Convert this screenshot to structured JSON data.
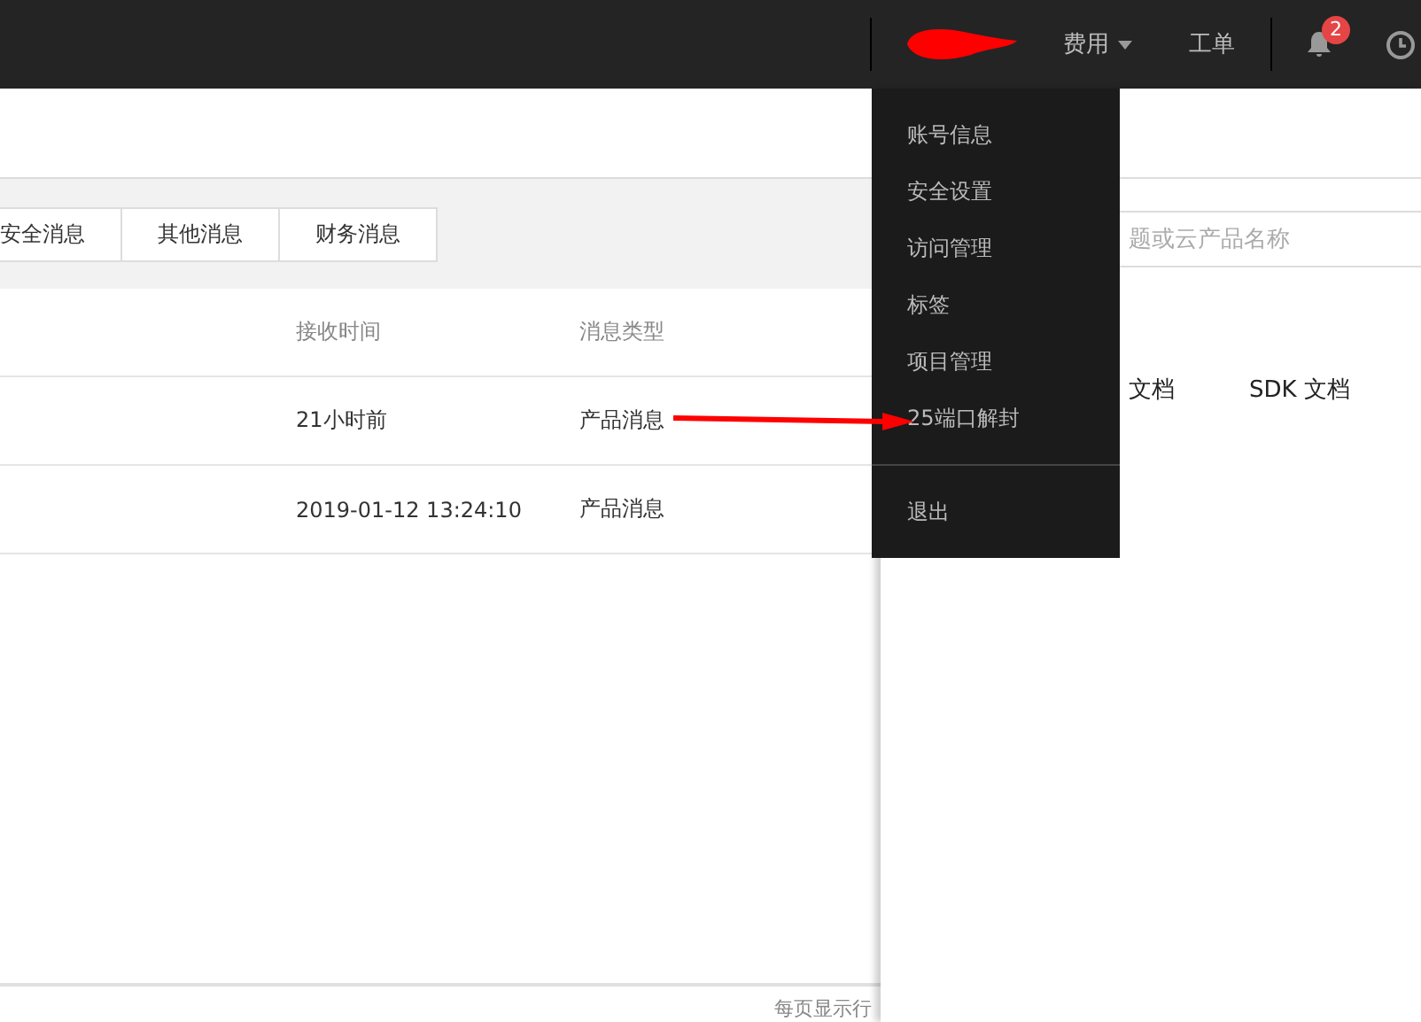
{
  "topbar": {
    "nav": [
      {
        "label": "费用",
        "dropdown": true
      },
      {
        "label": "工单",
        "dropdown": false
      }
    ],
    "notification_count": "2"
  },
  "tabs": [
    {
      "label": "安全消息",
      "selected": false
    },
    {
      "label": "其他消息",
      "selected": false
    },
    {
      "label": "财务消息",
      "selected": false
    }
  ],
  "table": {
    "columns": [
      "接收时间",
      "消息类型"
    ],
    "rows": [
      [
        "21小时前",
        "产品消息"
      ],
      [
        "2019-01-12 13:24:10",
        "产品消息"
      ]
    ]
  },
  "footer": {
    "page_size_label": "每页显示行"
  },
  "panel": {
    "search": {
      "placeholder": "题或云产品名称"
    },
    "links": [
      "文档",
      "SDK 文档"
    ]
  },
  "account_menu": {
    "items": [
      "账号信息",
      "安全设置",
      "访问管理",
      "标签",
      "项目管理",
      "25端口解封"
    ],
    "logout": "退出"
  }
}
